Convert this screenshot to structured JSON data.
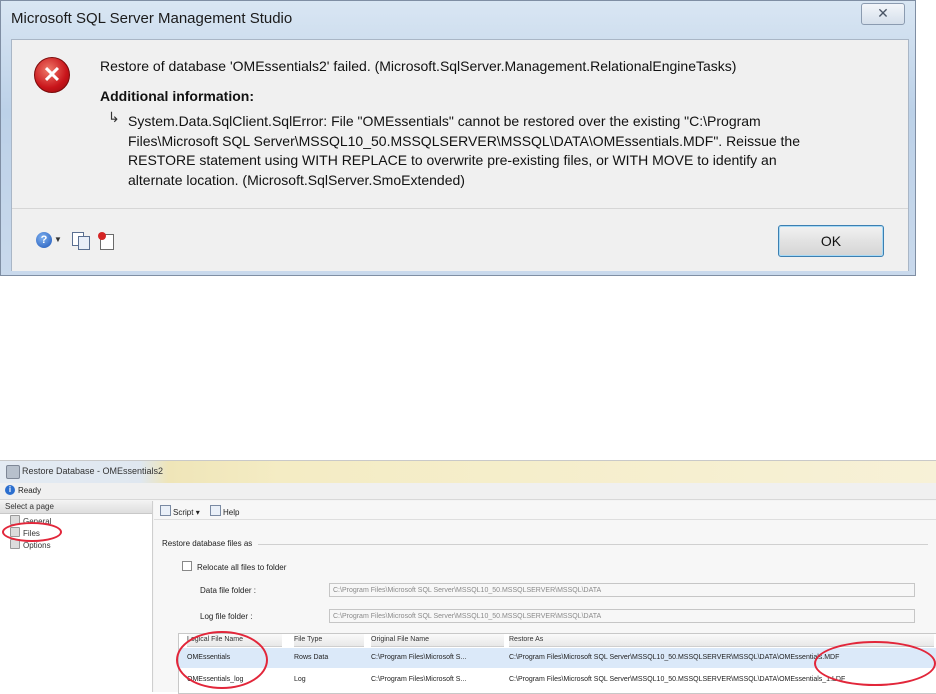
{
  "error_dialog": {
    "title": "Microsoft SQL Server Management Studio",
    "close_glyph": "✕",
    "message": "Restore of database 'OMEssentials2' failed. (Microsoft.SqlServer.Management.RelationalEngineTasks)",
    "additional_info_title": "Additional information:",
    "additional_info_arrow": "↳",
    "additional_info_text": "System.Data.SqlClient.SqlError: File \"OMEssentials\" cannot be restored over the existing \"C:\\Program Files\\Microsoft SQL Server\\MSSQL10_50.MSSQLSERVER\\MSSQL\\DATA\\OMEssentials.MDF\". Reissue the RESTORE statement using WITH REPLACE to overwrite pre-existing files, or WITH MOVE to identify an alternate location. (Microsoft.SqlServer.SmoExtended)",
    "ok_label": "OK",
    "icons": [
      "error-icon",
      "help-icon",
      "copy-icon",
      "details-icon"
    ]
  },
  "restore_window": {
    "title": "Restore Database - OMEssentials2",
    "status": "Ready",
    "sidebar": {
      "header": "Select a page",
      "items": [
        {
          "label": "General"
        },
        {
          "label": "Files"
        },
        {
          "label": "Options"
        }
      ]
    },
    "toolbar": {
      "script_label": "Script",
      "script_drop": "▾",
      "help_label": "Help"
    },
    "section_title": "Restore database files as",
    "relocate_label": "Relocate all files to folder",
    "data_folder_label": "Data file folder :",
    "data_folder_value": "C:\\Program Files\\Microsoft SQL Server\\MSSQL10_50.MSSQLSERVER\\MSSQL\\DATA",
    "log_folder_label": "Log file folder :",
    "log_folder_value": "C:\\Program Files\\Microsoft SQL Server\\MSSQL10_50.MSSQLSERVER\\MSSQL\\DATA",
    "grid": {
      "columns": [
        "Logical File Name",
        "File Type",
        "Original File Name",
        "Restore As"
      ],
      "rows": [
        [
          "OMEssentials",
          "Rows Data",
          "C:\\Program Files\\Microsoft S...",
          "C:\\Program Files\\Microsoft SQL Server\\MSSQL10_50.MSSQLSERVER\\MSSQL\\DATA\\OMEssentials.MDF"
        ],
        [
          "OMEssentials_log",
          "Log",
          "C:\\Program Files\\Microsoft S...",
          "C:\\Program Files\\Microsoft SQL Server\\MSSQL10_50.MSSQLSERVER\\MSSQL\\DATA\\OMEssentials_1.LDF"
        ]
      ]
    }
  }
}
